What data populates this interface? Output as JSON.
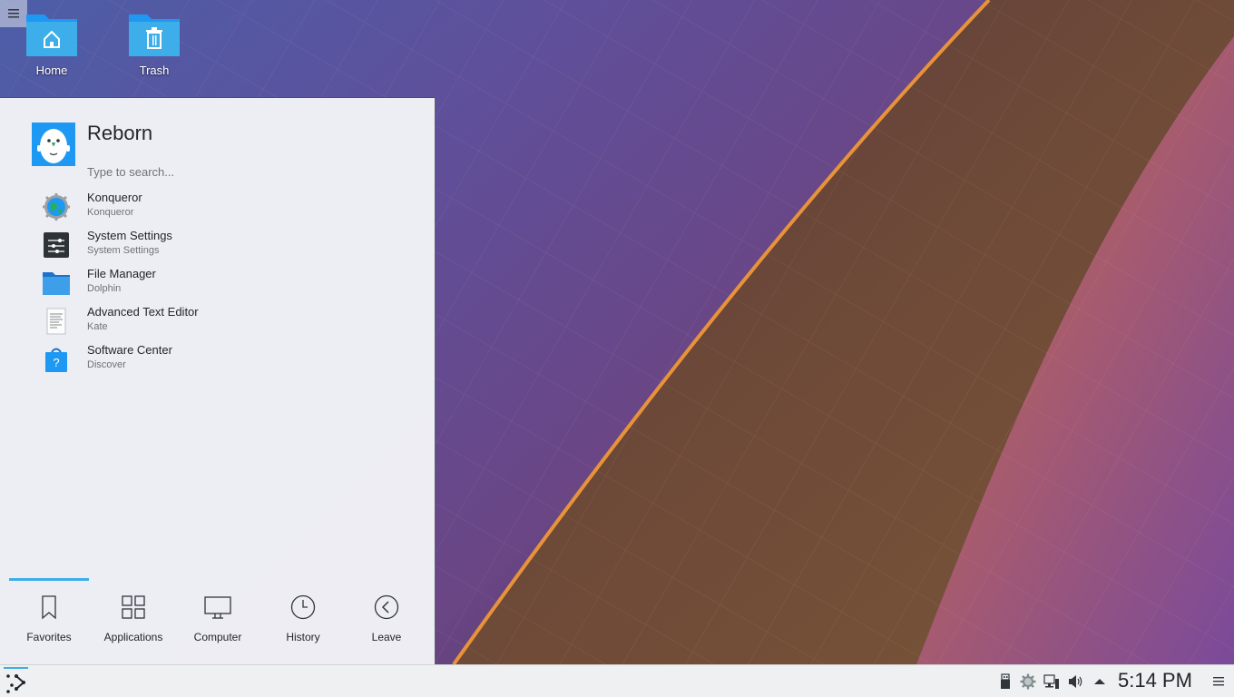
{
  "desktop": {
    "menu_icon": "hamburger-icon",
    "icons": [
      {
        "label": "Home",
        "icon": "home-folder-icon"
      },
      {
        "label": "Trash",
        "icon": "trash-icon"
      }
    ]
  },
  "launcher": {
    "username": "Reborn",
    "avatar_icon": "user-avatar-icon",
    "search": {
      "placeholder": "Type to search...",
      "value": ""
    },
    "favorites": [
      {
        "name": "Konqueror",
        "generic": "Konqueror",
        "icon": "konqueror-icon"
      },
      {
        "name": "System Settings",
        "generic": "System Settings",
        "icon": "system-settings-icon"
      },
      {
        "name": "File Manager",
        "generic": "Dolphin",
        "icon": "folder-icon"
      },
      {
        "name": "Advanced Text Editor",
        "generic": "Kate",
        "icon": "text-editor-icon"
      },
      {
        "name": "Software Center",
        "generic": "Discover",
        "icon": "software-center-icon"
      }
    ],
    "tabs": [
      {
        "label": "Favorites",
        "icon": "bookmark-icon",
        "active": true
      },
      {
        "label": "Applications",
        "icon": "applications-grid-icon",
        "active": false
      },
      {
        "label": "Computer",
        "icon": "computer-icon",
        "active": false
      },
      {
        "label": "History",
        "icon": "clock-icon",
        "active": false
      },
      {
        "label": "Leave",
        "icon": "leave-icon",
        "active": false
      }
    ],
    "accent_color": "#3daee9"
  },
  "panel": {
    "launcher_icon": "plasma-kicker-icon",
    "tray": [
      {
        "icon": "usb-device-icon"
      },
      {
        "icon": "updates-gear-icon"
      },
      {
        "icon": "network-icon"
      },
      {
        "icon": "volume-icon"
      },
      {
        "icon": "expand-tray-arrow-icon"
      }
    ],
    "clock": "5:14 PM",
    "menu_icon": "panel-options-icon"
  }
}
